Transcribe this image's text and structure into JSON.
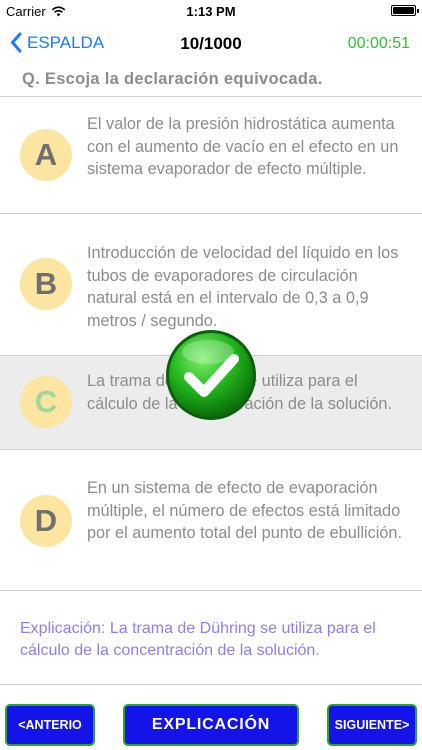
{
  "status_bar": {
    "carrier": "Carrier",
    "time": "1:13 PM",
    "wifi_icon": "wifi-icon",
    "battery_icon": "battery-icon"
  },
  "nav": {
    "back_label": "ESPALDA",
    "back_icon": "chevron-left-icon",
    "title": "10/1000",
    "timer": "00:00:51",
    "timer_color": "#2dc22d",
    "accent_color": "#1e7cf2"
  },
  "question": {
    "text": "Q. Escoja la declaración equivocada."
  },
  "options": [
    {
      "letter": "A",
      "text": "El valor de la presión hidrostática aumenta con el aumento de vacío en el efecto en un sistema evaporador de efecto múltiple."
    },
    {
      "letter": "B",
      "text": "Introducción de velocidad del líquido en los tubos de evaporadores de circulación natural está en el intervalo de 0,3 a 0,9 metros / segundo."
    },
    {
      "letter": "C",
      "text": "La trama de Dühring se utiliza para el cálculo de la concentración de la solución.",
      "selected": true,
      "correct": true
    },
    {
      "letter": "D",
      "text": "En un sistema de efecto de evaporación múltiple, el número de efectos está limitado por el aumento total del punto de ebullición."
    }
  ],
  "check_icon": "check-circle-icon",
  "explanation": {
    "text": "Explicación: La trama de Dühring se utiliza para el cálculo de la concentración de la solución.",
    "color": "#8f80e6"
  },
  "buttons": {
    "prev": "<ANTERIO",
    "explain": "EXPLICACIÓN",
    "next": "SIGUIENTE>",
    "bg_color": "#1414e8",
    "border_color": "#2aa52a"
  }
}
